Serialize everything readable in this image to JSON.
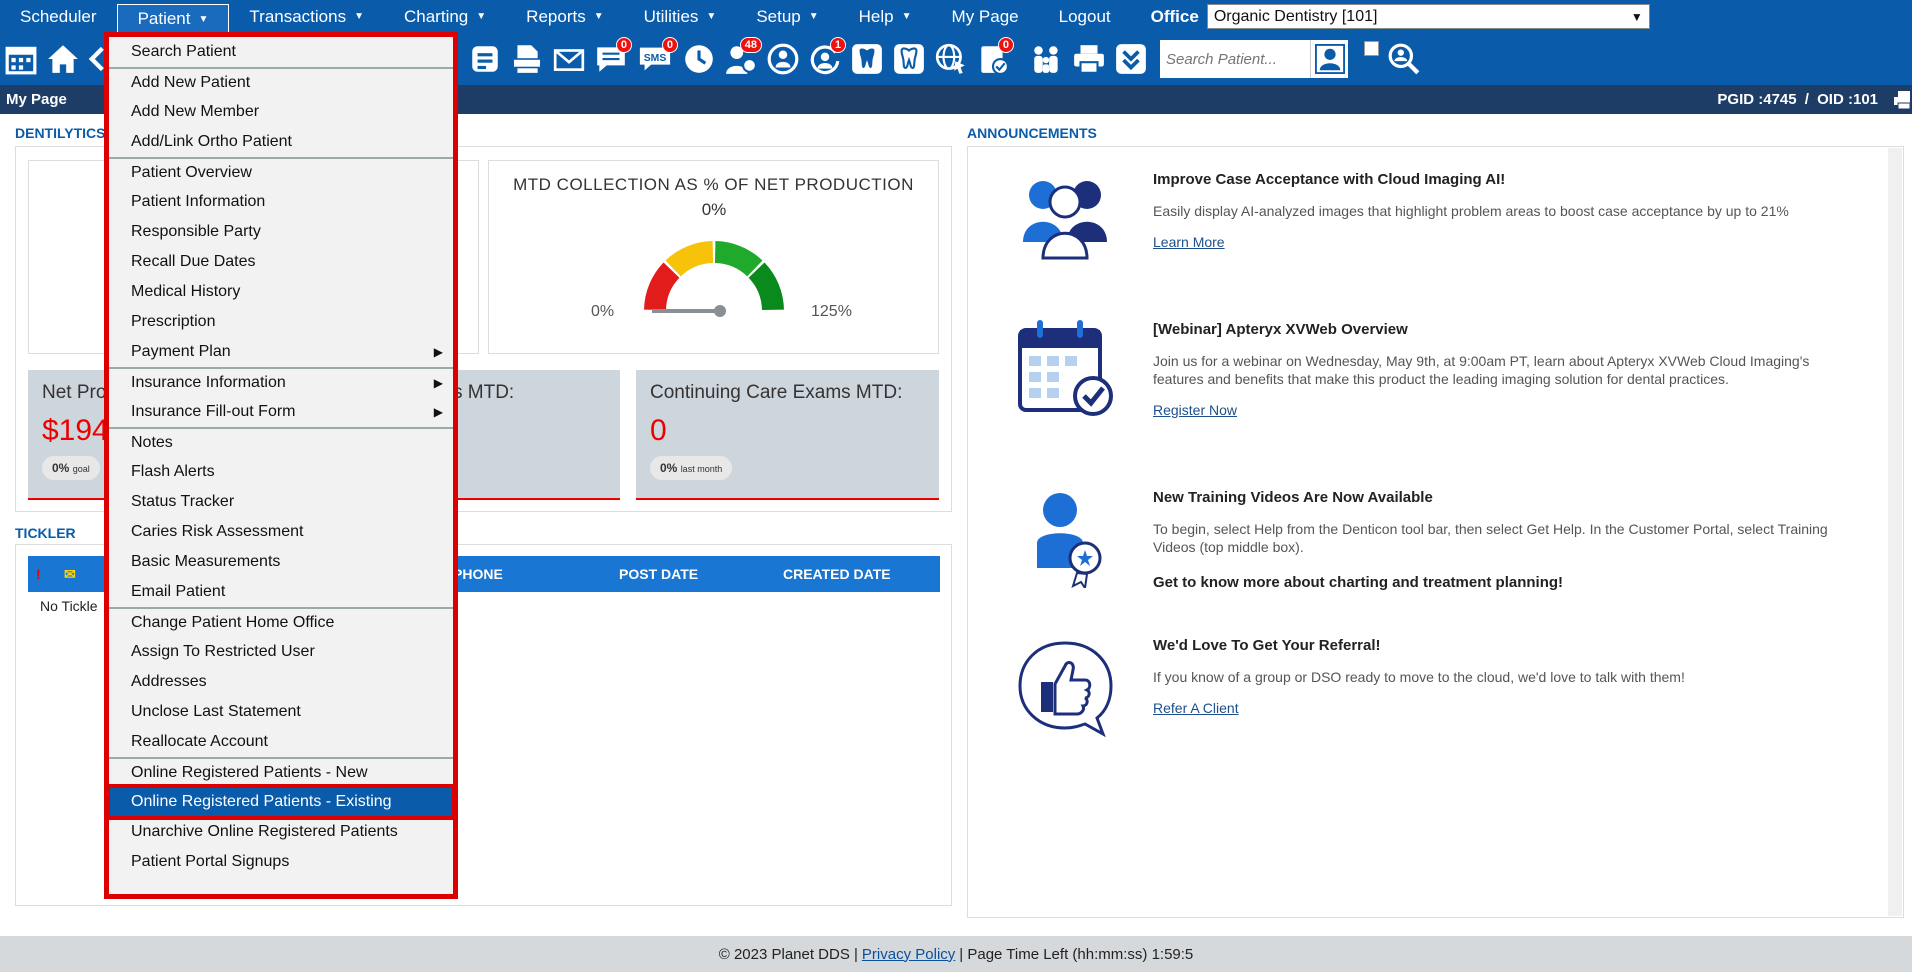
{
  "menu": {
    "items": [
      {
        "label": "Scheduler",
        "caret": false
      },
      {
        "label": "Patient",
        "caret": true,
        "active": true
      },
      {
        "label": "Transactions",
        "caret": true
      },
      {
        "label": "Charting",
        "caret": true
      },
      {
        "label": "Reports",
        "caret": true
      },
      {
        "label": "Utilities",
        "caret": true
      },
      {
        "label": "Setup",
        "caret": true
      },
      {
        "label": "Help",
        "caret": true
      },
      {
        "label": "My Page",
        "caret": false
      },
      {
        "label": "Logout",
        "caret": false
      }
    ],
    "office_label": "Office",
    "office_value": "Organic Dentistry [101]"
  },
  "toolbar": {
    "search_placeholder": "Search Patient...",
    "badges": {
      "messages": "0",
      "sms": "0",
      "users": "48",
      "alerts": "1",
      "notes": "0"
    },
    "sms_label": "SMS"
  },
  "pagebar": {
    "title": "My Page",
    "pgid_label": "PGID :4745",
    "sep": "/",
    "oid_label": "OID :101"
  },
  "sections": {
    "dentilytics": "DENTILYTICS",
    "announcements": "ANNOUNCEMENTS",
    "tickler": "TICKLER"
  },
  "gauge": {
    "title": "MTD COLLECTION AS % OF NET PRODUCTION",
    "value_label": "0%",
    "min_label": "0%",
    "max_label": "125%",
    "value": 0,
    "colors": [
      "#e21b1b",
      "#f7c20a",
      "#1faa2b",
      "#0a8a1c"
    ]
  },
  "stats": [
    {
      "label": "Net Pro",
      "value": "$194",
      "pill": "0%",
      "pill_sub": "goal"
    },
    {
      "label": "s MTD:",
      "value": "",
      "pill": "",
      "pill_sub": ""
    },
    {
      "label": "Continuing Care Exams MTD:",
      "value": "0",
      "pill": "0%",
      "pill_sub": "last month"
    }
  ],
  "tickler": {
    "columns": [
      "PHONE",
      "POST DATE",
      "CREATED DATE"
    ],
    "empty_text": "No Tickle"
  },
  "announcements": [
    {
      "title": "Improve Case Acceptance with Cloud Imaging AI!",
      "body": "Easily display AI-analyzed images that highlight problem areas to boost case acceptance by up to 21%",
      "link": "Learn More",
      "icon": "people-group-icon"
    },
    {
      "title": "[Webinar] Apteryx XVWeb Overview",
      "body": "Join us for a webinar on Wednesday, May 9th, at 9:00am PT, learn about Apteryx XVWeb Cloud Imaging's features and benefits that make this product the leading imaging solution for dental practices.",
      "link": "Register Now",
      "icon": "calendar-check-icon"
    },
    {
      "title": "New Training Videos Are Now Available",
      "body": "To begin, select Help from the Denticon tool bar, then select Get Help. In the Customer Portal, select Training Videos (top middle box).",
      "bold": "Get to know more about charting and treatment planning!",
      "link": "",
      "icon": "award-person-icon"
    },
    {
      "title": "We'd Love To Get Your Referral!",
      "body": "If you know of a group or DSO ready to move to the cloud, we'd love to talk with them!",
      "link": "Refer A Client",
      "icon": "thumbs-up-icon"
    }
  ],
  "dropdown": {
    "items": [
      {
        "label": "Search Patient"
      },
      {
        "label": "Add New Patient",
        "sep": true
      },
      {
        "label": "Add New Member"
      },
      {
        "label": "Add/Link Ortho Patient"
      },
      {
        "label": "Patient Overview",
        "sep": true
      },
      {
        "label": "Patient Information"
      },
      {
        "label": "Responsible Party"
      },
      {
        "label": "Recall Due Dates"
      },
      {
        "label": "Medical History"
      },
      {
        "label": "Prescription"
      },
      {
        "label": "Payment Plan",
        "sub": true
      },
      {
        "label": "Insurance Information",
        "sub": true,
        "sep": true
      },
      {
        "label": "Insurance Fill-out Form",
        "sub": true
      },
      {
        "label": "Notes",
        "sep": true
      },
      {
        "label": "Flash Alerts"
      },
      {
        "label": "Status Tracker"
      },
      {
        "label": "Caries Risk Assessment"
      },
      {
        "label": "Basic Measurements"
      },
      {
        "label": "Email Patient"
      },
      {
        "label": "Change Patient Home Office",
        "sep": true
      },
      {
        "label": "Assign To Restricted User"
      },
      {
        "label": "Addresses"
      },
      {
        "label": "Unclose Last Statement"
      },
      {
        "label": "Reallocate Account"
      },
      {
        "label": "Online Registered Patients - New",
        "sep": true
      },
      {
        "label": "Online Registered Patients - Existing",
        "selected": true
      },
      {
        "label": "Unarchive Online Registered Patients"
      },
      {
        "label": "Patient Portal Signups"
      }
    ]
  },
  "footer": {
    "copyright": "© 2023 Planet DDS |",
    "privacy": "Privacy Policy",
    "time_label": "| Page Time Left (hh:mm:ss) 1:59:5"
  }
}
